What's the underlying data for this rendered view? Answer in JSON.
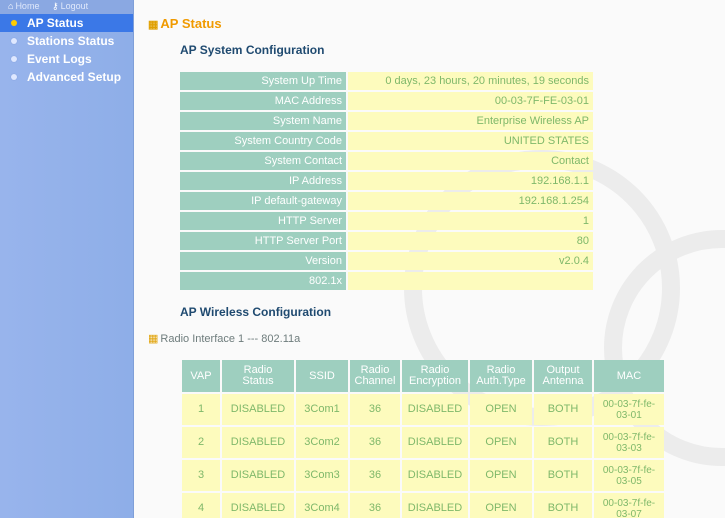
{
  "topbar": {
    "home": "Home",
    "logout": "Logout"
  },
  "sidebar": {
    "items": [
      {
        "label": "AP Status",
        "active": true
      },
      {
        "label": "Stations Status",
        "active": false
      },
      {
        "label": "Event Logs",
        "active": false
      },
      {
        "label": "Advanced Setup",
        "active": false
      }
    ]
  },
  "page": {
    "title": "AP Status",
    "system_config_title": "AP System Configuration",
    "wireless_config_title": "AP Wireless Configuration",
    "radio_interface_label": "Radio Interface 1 --- 802.11a"
  },
  "system": [
    {
      "label": "System Up Time",
      "value": "0 days, 23 hours, 20 minutes, 19 seconds"
    },
    {
      "label": "MAC Address",
      "value": "00-03-7F-FE-03-01"
    },
    {
      "label": "System Name",
      "value": "Enterprise Wireless AP"
    },
    {
      "label": "System Country Code",
      "value": "UNITED STATES"
    },
    {
      "label": "System Contact",
      "value": "Contact"
    },
    {
      "label": "IP Address",
      "value": "192.168.1.1"
    },
    {
      "label": "IP default-gateway",
      "value": "192.168.1.254"
    },
    {
      "label": "HTTP Server",
      "value": "1"
    },
    {
      "label": "HTTP Server Port",
      "value": "80"
    },
    {
      "label": "Version",
      "value": "v2.0.4"
    },
    {
      "label": "802.1x",
      "value": ""
    }
  ],
  "vap": {
    "headers": [
      {
        "l1": "VAP",
        "l2": ""
      },
      {
        "l1": "Radio",
        "l2": "Status"
      },
      {
        "l1": "SSID",
        "l2": ""
      },
      {
        "l1": "Radio",
        "l2": "Channel"
      },
      {
        "l1": "Radio",
        "l2": "Encryption"
      },
      {
        "l1": "Radio",
        "l2": "Auth.Type"
      },
      {
        "l1": "Output",
        "l2": "Antenna"
      },
      {
        "l1": "MAC",
        "l2": ""
      }
    ],
    "rows": [
      {
        "vap": "1",
        "status": "DISABLED",
        "ssid": "3Com1",
        "channel": "36",
        "encryption": "DISABLED",
        "auth": "OPEN",
        "antenna": "BOTH",
        "mac1": "00-03-7f-fe-",
        "mac2": "03-01"
      },
      {
        "vap": "2",
        "status": "DISABLED",
        "ssid": "3Com2",
        "channel": "36",
        "encryption": "DISABLED",
        "auth": "OPEN",
        "antenna": "BOTH",
        "mac1": "00-03-7f-fe-",
        "mac2": "03-03"
      },
      {
        "vap": "3",
        "status": "DISABLED",
        "ssid": "3Com3",
        "channel": "36",
        "encryption": "DISABLED",
        "auth": "OPEN",
        "antenna": "BOTH",
        "mac1": "00-03-7f-fe-",
        "mac2": "03-05"
      },
      {
        "vap": "4",
        "status": "DISABLED",
        "ssid": "3Com4",
        "channel": "36",
        "encryption": "DISABLED",
        "auth": "OPEN",
        "antenna": "BOTH",
        "mac1": "00-03-7f-fe-",
        "mac2": "03-07"
      }
    ]
  },
  "colors": {
    "sidebar_bg": "#98b4ec",
    "active_item": "#3b78e7",
    "title_orange": "#f09a00",
    "label_cell": "#9ecfbf",
    "value_cell": "#fdfbbd",
    "value_text": "#7fb86a"
  }
}
